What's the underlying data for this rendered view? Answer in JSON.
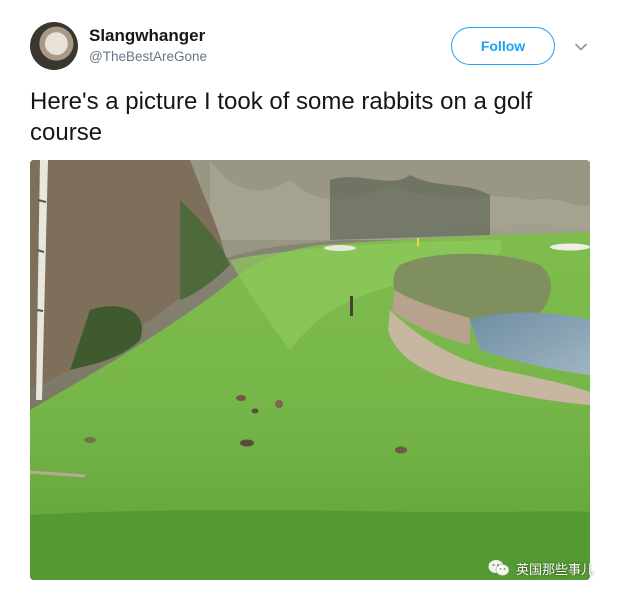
{
  "tweet": {
    "display_name": "Slangwhanger",
    "handle": "@TheBestAreGone",
    "follow_label": "Follow",
    "text": "Here's a picture I took of some rabbits on a golf course"
  },
  "photo": {
    "subject": "golf-course-rabbits"
  },
  "watermark": {
    "text": "英国那些事儿"
  },
  "colors": {
    "accent": "#1da1f2",
    "secondary_text": "#657786"
  }
}
